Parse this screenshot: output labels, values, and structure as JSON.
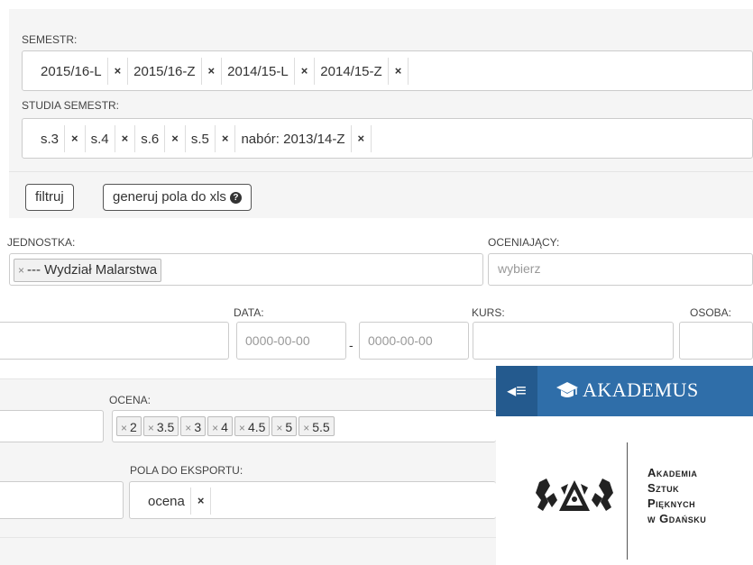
{
  "semestr": {
    "label": "SEMESTR:",
    "tags": [
      "2015/16-L",
      "2015/16-Z",
      "2014/15-L",
      "2014/15-Z"
    ],
    "remove": "×"
  },
  "studia": {
    "label": "STUDIA SEMESTR:",
    "tags": [
      "s.3",
      "s.4",
      "s.6",
      "s.5",
      "nabór: 2013/14-Z"
    ],
    "remove": "×"
  },
  "buttons": {
    "filter": "filtruj",
    "xls": "generuj pola do xls"
  },
  "jednostka": {
    "label": "JEDNOSTKA:",
    "remove": "×",
    "value": "--- Wydział Malarstwa"
  },
  "oceniajacy": {
    "label": "OCENIAJĄCY:",
    "placeholder": "wybierz"
  },
  "data": {
    "label": "DATA:",
    "from": "0000-00-00",
    "sep": "-",
    "to": "0000-00-00"
  },
  "kurs": {
    "label": "KURS:"
  },
  "osoba": {
    "label": "OSOBA:"
  },
  "ocena": {
    "label": "OCENA:",
    "remove": "×",
    "tags": [
      "2",
      "3.5",
      "3",
      "4",
      "4.5",
      "5",
      "5.5"
    ]
  },
  "pola": {
    "label": "POLA DO EKSPORTU:",
    "tags": [
      "ocena"
    ],
    "remove": "×"
  },
  "akademus": {
    "title": "AKADEMUS",
    "menu_glyph": "◂≡",
    "brand_color": "#2f6ea9",
    "org_lines": [
      "Akademia",
      "Sztuk",
      "Pięknych",
      "w Gdańsku"
    ]
  }
}
